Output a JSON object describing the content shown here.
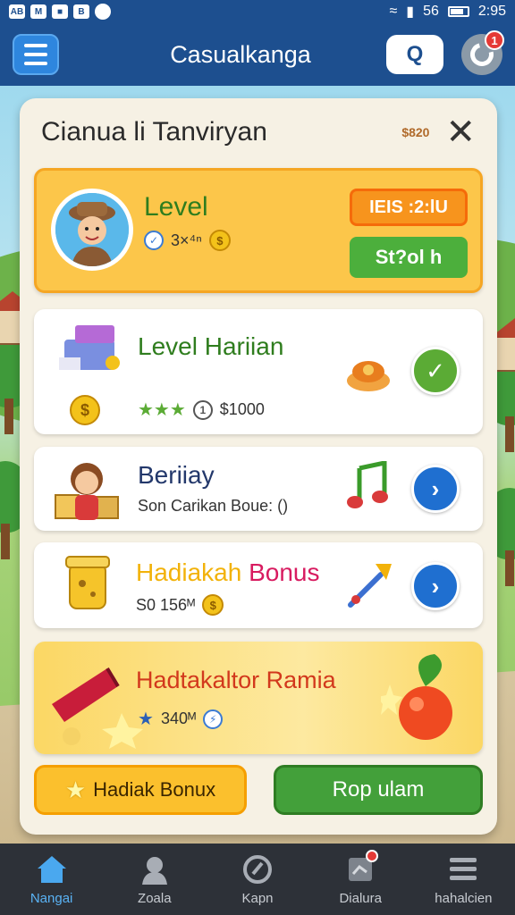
{
  "status_bar": {
    "left_icons": [
      "AB",
      "M",
      "B"
    ],
    "time": "2:95",
    "indicators": [
      "wifi-icon",
      "signal-icon",
      "battery-icon"
    ],
    "carrier": "56"
  },
  "app_bar": {
    "title": "Casualkanga",
    "search_glyph": "Q",
    "notification_count": "1"
  },
  "panel": {
    "title": "Cianua li Tanviryan",
    "meta": "$820",
    "close_glyph": "✕"
  },
  "level_card": {
    "title": "Level",
    "sub_value": "3×⁴ⁿ",
    "timer": "IEIS :2:lU",
    "start_label": "St?ol h"
  },
  "daily_card": {
    "title": "Level Hariian",
    "stars": "★★★",
    "reward": "$1000"
  },
  "birthday_card": {
    "title": "Beriiay",
    "sub": "Son Carikan Boue: ()"
  },
  "gift_card": {
    "title_a": "Hadiakah",
    "title_b": "Bonus",
    "sub": "S0 156ᴹ"
  },
  "special_card": {
    "title": "Hadtakaltor Ramia",
    "sub": "340ᴹ"
  },
  "buttons": {
    "bonus_label": "Hadiak Bonux",
    "play_label": "Rop ulam"
  },
  "nav": [
    {
      "label": "Nangai",
      "icon": "home-icon"
    },
    {
      "label": "Zoala",
      "icon": "profile-icon"
    },
    {
      "label": "Kapn",
      "icon": "compass-icon"
    },
    {
      "label": "Dialura",
      "icon": "tasks-icon"
    },
    {
      "label": "hahalcien",
      "icon": "menu-icon"
    }
  ],
  "colors": {
    "app_bar": "#1d4f8f",
    "accent_green": "#4caf3c",
    "accent_orange": "#f7941d",
    "accent_blue": "#1f6fd0",
    "nav_active": "#5ab3f5"
  }
}
